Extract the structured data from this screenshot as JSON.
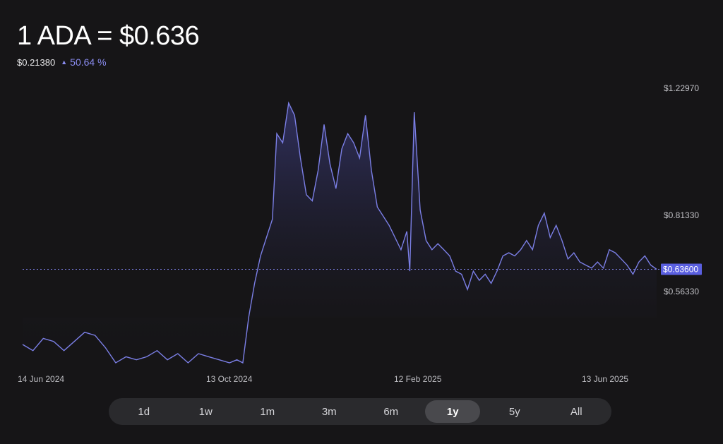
{
  "header": {
    "title": "1 ADA = $0.636",
    "base_price": "$0.21380",
    "change_icon": "up-triangle-icon",
    "change": "50.64 %"
  },
  "colors": {
    "line": "#7b7fe6",
    "fill_top": "#3a3a78",
    "current_badge": "#5a5fe0",
    "background": "#161517"
  },
  "current_label": "$0.63600",
  "ranges": [
    "1d",
    "1w",
    "1m",
    "3m",
    "6m",
    "1y",
    "5y",
    "All"
  ],
  "active_range": "1y",
  "chart_data": {
    "type": "area",
    "title": "1 ADA = $0.636",
    "x_labels": [
      "14 Jun 2024",
      "13 Oct 2024",
      "12 Feb 2025",
      "13 Jun 2025"
    ],
    "y_labels": [
      "$1.22970",
      "$0.81330",
      "$0.56330"
    ],
    "ylim": [
      0.27,
      1.24
    ],
    "x": [
      "2024-06-14",
      "2024-06-21",
      "2024-06-28",
      "2024-07-05",
      "2024-07-12",
      "2024-07-19",
      "2024-07-26",
      "2024-08-02",
      "2024-08-09",
      "2024-08-16",
      "2024-08-23",
      "2024-08-30",
      "2024-09-06",
      "2024-09-13",
      "2024-09-20",
      "2024-09-27",
      "2024-10-04",
      "2024-10-11",
      "2024-10-18",
      "2024-10-25",
      "2024-11-01",
      "2024-11-06",
      "2024-11-10",
      "2024-11-14",
      "2024-11-18",
      "2024-11-22",
      "2024-11-26",
      "2024-11-30",
      "2024-12-03",
      "2024-12-07",
      "2024-12-11",
      "2024-12-15",
      "2024-12-19",
      "2024-12-23",
      "2024-12-27",
      "2024-12-31",
      "2025-01-04",
      "2025-01-08",
      "2025-01-12",
      "2025-01-16",
      "2025-01-20",
      "2025-01-24",
      "2025-01-28",
      "2025-02-01",
      "2025-02-05",
      "2025-02-09",
      "2025-02-13",
      "2025-02-17",
      "2025-02-21",
      "2025-02-25",
      "2025-03-01",
      "2025-03-03",
      "2025-03-06",
      "2025-03-10",
      "2025-03-14",
      "2025-03-18",
      "2025-03-22",
      "2025-03-26",
      "2025-03-30",
      "2025-04-03",
      "2025-04-07",
      "2025-04-11",
      "2025-04-15",
      "2025-04-19",
      "2025-04-23",
      "2025-04-27",
      "2025-05-01",
      "2025-05-05",
      "2025-05-09",
      "2025-05-13",
      "2025-05-17",
      "2025-05-21",
      "2025-05-25",
      "2025-05-29",
      "2025-06-02",
      "2025-06-06",
      "2025-06-10",
      "2025-06-14",
      "2025-06-18",
      "2025-06-22",
      "2025-06-26",
      "2025-06-30",
      "2025-07-04",
      "2025-07-08",
      "2025-07-12",
      "2025-07-16",
      "2025-07-20",
      "2025-07-24",
      "2025-07-28",
      "2025-08-01",
      "2025-08-05",
      "2025-08-09",
      "2025-08-13",
      "2025-08-17"
    ],
    "series": [
      {
        "values": [
          0.39,
          0.37,
          0.41,
          0.4,
          0.37,
          0.4,
          0.43,
          0.42,
          0.38,
          0.33,
          0.35,
          0.34,
          0.35,
          0.37,
          0.34,
          0.36,
          0.33,
          0.36,
          0.35,
          0.34,
          0.33,
          0.34,
          0.33,
          0.48,
          0.59,
          0.68,
          0.74,
          0.8,
          1.08,
          1.05,
          1.18,
          1.14,
          1.0,
          0.88,
          0.86,
          0.96,
          1.11,
          0.98,
          0.9,
          1.03,
          1.08,
          1.05,
          1.0,
          1.14,
          0.96,
          0.84,
          0.81,
          0.78,
          0.74,
          0.7,
          0.76,
          0.63,
          1.15,
          0.83,
          0.73,
          0.7,
          0.72,
          0.7,
          0.68,
          0.63,
          0.62,
          0.57,
          0.63,
          0.6,
          0.62,
          0.59,
          0.63,
          0.68,
          0.69,
          0.68,
          0.7,
          0.73,
          0.7,
          0.78,
          0.82,
          0.74,
          0.78,
          0.73,
          0.67,
          0.69,
          0.66,
          0.65,
          0.64,
          0.66,
          0.64,
          0.7,
          0.69,
          0.67,
          0.65,
          0.62,
          0.66,
          0.68,
          0.65,
          0.636
        ]
      }
    ]
  }
}
